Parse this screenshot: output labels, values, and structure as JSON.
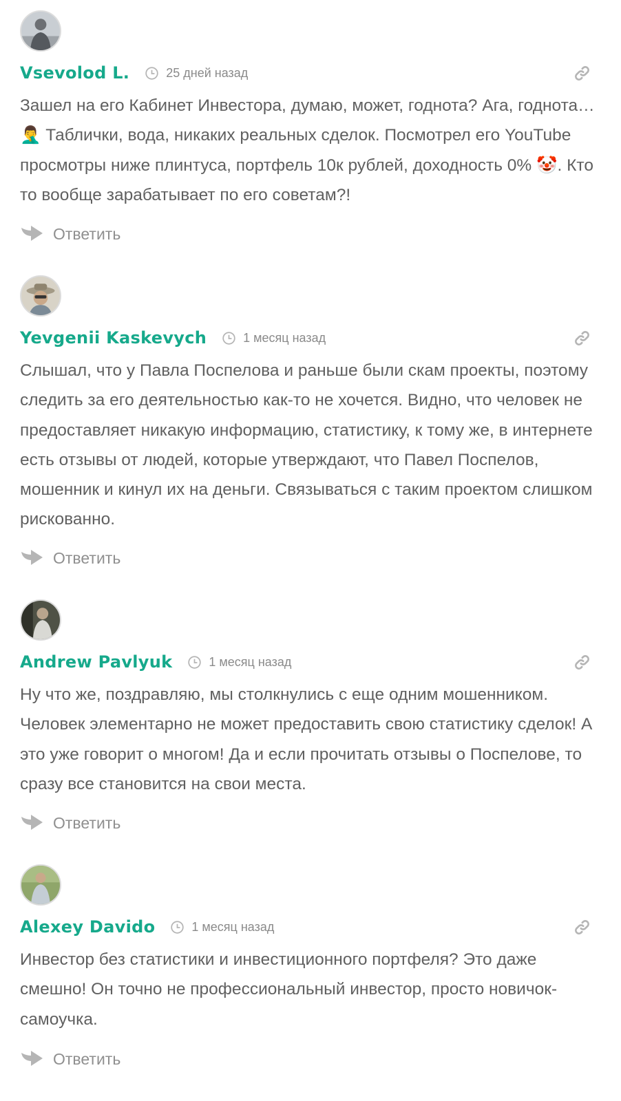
{
  "comments": [
    {
      "author": "Vsevolod L.",
      "time": "25 дней назад",
      "text": "Зашел на его Кабинет Инвестора, думаю, может, годнота? Ага, годнота… 🤦‍♂️ Таблички, вода, никаких реальных сделок. Посмотрел его YouTube просмотры ниже плинтуса, портфель 10к рублей, доходность 0% 🤡. Кто то вообще зарабатывает по его советам?!",
      "reply_label": "Ответить"
    },
    {
      "author": "Yevgenii Kaskevych",
      "time": "1 месяц назад",
      "text": "Слышал, что у Павла Поспелова и раньше были скам проекты, поэтому следить за его деятельностью как-то не хочется. Видно, что человек не предоставляет никакую информацию, статистику, к тому же, в интернете есть отзывы от людей, которые утверждают, что Павел Поспелов, мошенник и кинул их на деньги. Связываться с таким проектом слишком рискованно.",
      "reply_label": "Ответить"
    },
    {
      "author": "Andrew Pavlyuk",
      "time": "1 месяц назад",
      "text": "Ну что же, поздравляю, мы столкнулись с еще одним мошенником. Человек элементарно не может предоставить свою статистику сделок! А это уже говорит о многом! Да и если прочитать отзывы о Поспелове, то сразу все становится на свои места.",
      "reply_label": "Ответить"
    },
    {
      "author": "Alexey Davido",
      "time": "1 месяц назад",
      "text": "Инвестор без статистики и инвестиционного портфеля? Это даже смешно! Он точно не профессиональный инвестор, просто новичок-самоучка.",
      "reply_label": "Ответить"
    }
  ],
  "icons": {
    "time": "clock-icon",
    "link": "link-icon",
    "reply": "reply-arrow-icon"
  },
  "colors": {
    "author": "#16a98b",
    "text": "#606060",
    "meta": "#8a8a8a",
    "icon": "#b5b5b5"
  }
}
